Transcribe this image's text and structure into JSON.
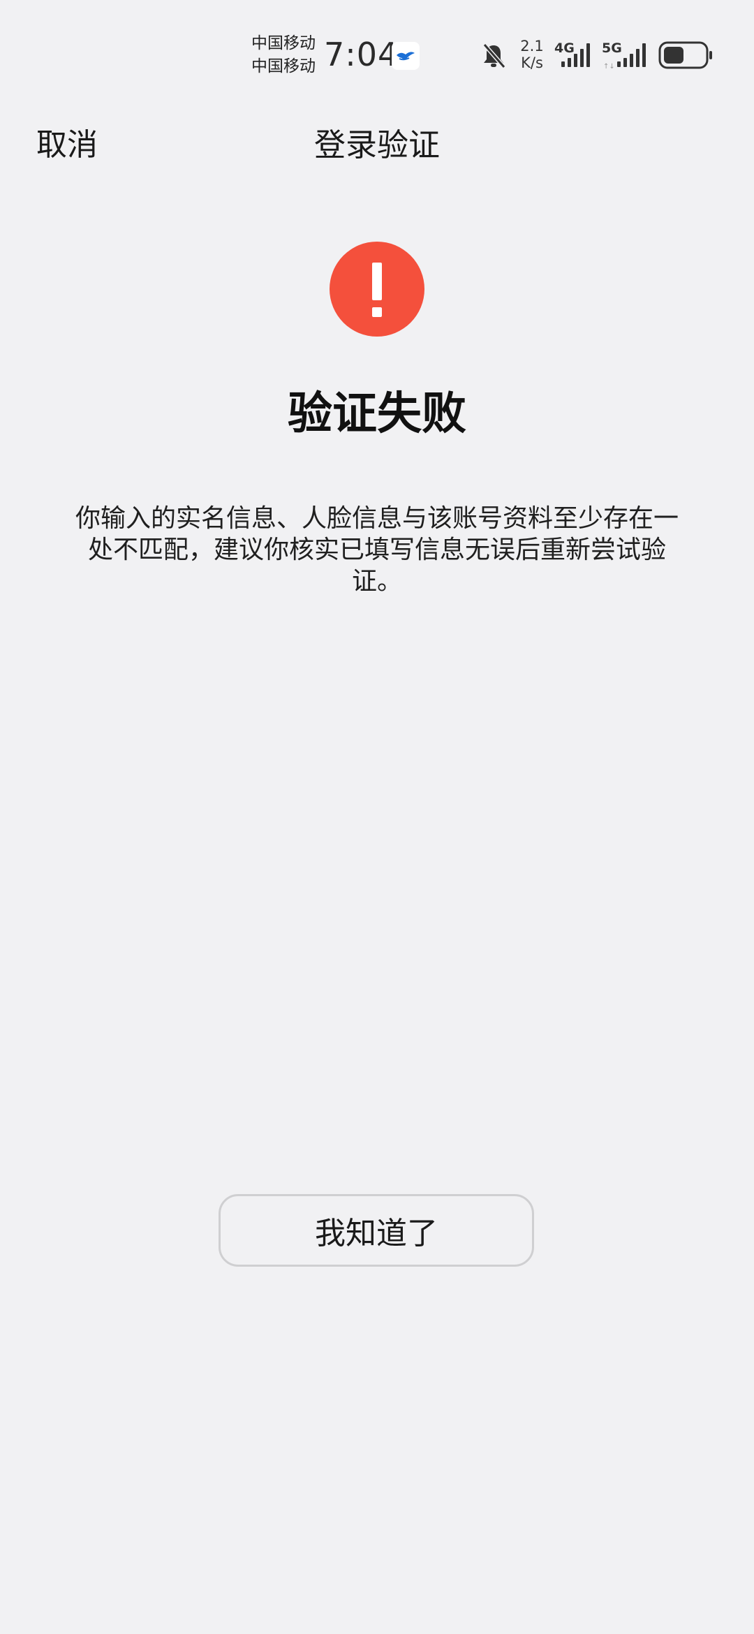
{
  "status_bar": {
    "carrier_1": "中国移动",
    "carrier_2": "中国移动",
    "time": "7:04",
    "net_speed_value": "2.1",
    "net_speed_unit": "K/s",
    "signal_1_tech": "4G",
    "signal_2_tech": "5G",
    "battery_level": 0.5
  },
  "nav": {
    "cancel_label": "取消",
    "title": "登录验证"
  },
  "result": {
    "title": "验证失败",
    "description": "你输入的实名信息、人脸信息与该账号资料至少存在一处不匹配，建议你核实已填写信息无误后重新尝试验证。"
  },
  "actions": {
    "confirm_label": "我知道了"
  },
  "colors": {
    "background": "#f1f1f3",
    "error": "#f4503c",
    "button_border": "#cfcfd1"
  }
}
